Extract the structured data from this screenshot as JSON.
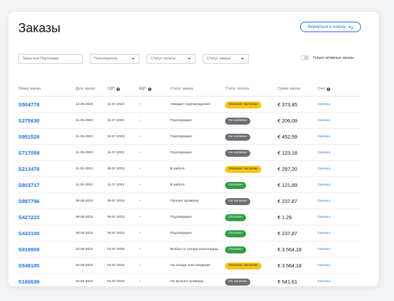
{
  "page": {
    "title": "Заказы",
    "back_label": "Вернуться к поиску"
  },
  "filters": {
    "search_placeholder": "Заказ или Партномер",
    "user_label": "Пользователь",
    "payment_status_label": "Статус оплаты",
    "order_status_label": "Статус заказа",
    "active_only_label": "Только активные заказы"
  },
  "columns": {
    "order_number": "Номер заказа",
    "order_date": "Дата заказа",
    "odp": "ОДП",
    "fdp": "ФДП",
    "order_status": "Статус заказа",
    "payment_status": "Статус оплаты",
    "order_sum": "Сумма заказа",
    "invoice": "Счет"
  },
  "colors": {
    "accent": "#1a73e8",
    "badge_partial": "#f5c518",
    "badge_unpaid": "#6b6f75",
    "badge_paid": "#2f9e44"
  },
  "rows": [
    {
      "num": "S504778",
      "date": "14.05.2023",
      "odp": "14.07.2023",
      "fdp": "–",
      "status": "Ожидает подтверждения",
      "pay": "Оплачен частично",
      "pay_kind": "partial",
      "sum": "€ 373,45",
      "dl": "Скачать"
    },
    {
      "num": "S275630",
      "date": "11.05.2023",
      "odp": "11.07.2023",
      "fdp": "–",
      "status": "Подтвержден",
      "pay": "Не оплачен",
      "pay_kind": "unpaid",
      "sum": "€ 206,09",
      "dl": "Скачать"
    },
    {
      "num": "S951529",
      "date": "11.05.2023",
      "odp": "04.07.2023",
      "fdp": "–",
      "status": "Подтвержден",
      "pay": "Не оплачен",
      "pay_kind": "unpaid",
      "sum": "€ 452,59",
      "dl": "Скачать"
    },
    {
      "num": "S717058",
      "date": "11.05.2023",
      "odp": "11.07.2023",
      "fdp": "–",
      "status": "Подтвержден",
      "pay": "Не оплачен",
      "pay_kind": "unpaid",
      "sum": "€ 123,18",
      "dl": "Скачать"
    },
    {
      "num": "S213478",
      "date": "11.05.2023",
      "odp": "08.07.2023",
      "fdp": "–",
      "status": "В работе",
      "pay": "Оплачен частично",
      "pay_kind": "partial",
      "sum": "€ 297,20",
      "dl": "Скачать"
    },
    {
      "num": "S803717",
      "date": "11.05.2023",
      "odp": "11.07.2023",
      "fdp": "–",
      "status": "В работе",
      "pay": "Оплачен",
      "pay_kind": "paid",
      "sum": "€ 121,89",
      "dl": "Скачать"
    },
    {
      "num": "S997796",
      "date": "09.05.2023",
      "odp": "09.07.2023",
      "fdp": "–",
      "status": "Прошел проверку",
      "pay": "Не оплачен",
      "pay_kind": "unpaid",
      "sum": "€ 237,87",
      "dl": "Скачать"
    },
    {
      "num": "S427223",
      "date": "09.05.2023",
      "odp": "09.07.2023",
      "fdp": "–",
      "status": "Подтвержден",
      "pay": "Оплачен",
      "pay_kind": "paid",
      "sum": "€ 1,29",
      "dl": "Скачать"
    },
    {
      "num": "S433100",
      "date": "09.05.2023",
      "odp": "09.07.2023",
      "fdp": "–",
      "status": "Подтвержден",
      "pay": "Оплачен",
      "pay_kind": "paid",
      "sum": "€ 237,87",
      "dl": "Скачать"
    },
    {
      "num": "S919909",
      "date": "03.05.2023",
      "odp": "03.07.2023",
      "fdp": "–",
      "status": "Выбыл со склада консолидац...",
      "pay": "Оплачен",
      "pay_kind": "paid",
      "sum": "€ 3 564,18",
      "dl": "Скачать"
    },
    {
      "num": "S548185",
      "date": "03.05.2023",
      "odp": "03.07.2023",
      "fdp": "–",
      "status": "На складе консолидации",
      "pay": "Оплачен частично",
      "pay_kind": "partial",
      "sum": "€ 3 564,18",
      "dl": "Скачать"
    },
    {
      "num": "S160639",
      "date": "03.05.2023",
      "odp": "03.07.2023",
      "fdp": "–",
      "status": "Не прошел проверку",
      "pay": "Не оплачен",
      "pay_kind": "unpaid",
      "sum": "€ 541,61",
      "dl": "Скачать"
    }
  ]
}
